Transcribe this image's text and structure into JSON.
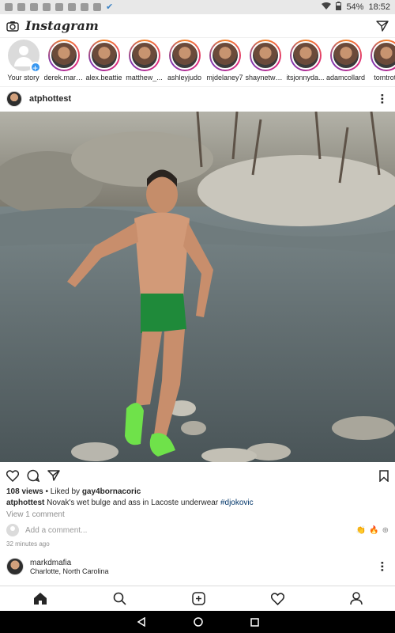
{
  "status_bar": {
    "battery": "54%",
    "time": "18:52"
  },
  "app": {
    "title": "Instagram"
  },
  "stories": [
    {
      "name": "Your story",
      "own": true
    },
    {
      "name": "derek.mart..."
    },
    {
      "name": "alex.beattie"
    },
    {
      "name": "matthew_..."
    },
    {
      "name": "ashleyjudo"
    },
    {
      "name": "mjdelaney7"
    },
    {
      "name": "shaynetwa..."
    },
    {
      "name": "itsjonnyda..."
    },
    {
      "name": "adamcollard"
    },
    {
      "name": "tomtrott"
    }
  ],
  "post": {
    "username": "atphottest",
    "views": "108 views",
    "liked_by_prefix": "Liked by",
    "liked_by_user": "gay4bornacoric",
    "caption_user": "atphottest",
    "caption_text": "Novak's wet bulge and ass in Lacoste underwear",
    "caption_tag": "#djokovic",
    "view_comments": "View 1 comment",
    "add_comment_placeholder": "Add a comment...",
    "time_ago": "32 minutes ago"
  },
  "next_post": {
    "username": "markdmafia",
    "location": "Charlotte, North Carolina"
  },
  "colors": {
    "link": "#003569",
    "accent": "#3897f0",
    "muted": "#8e8e8e"
  }
}
